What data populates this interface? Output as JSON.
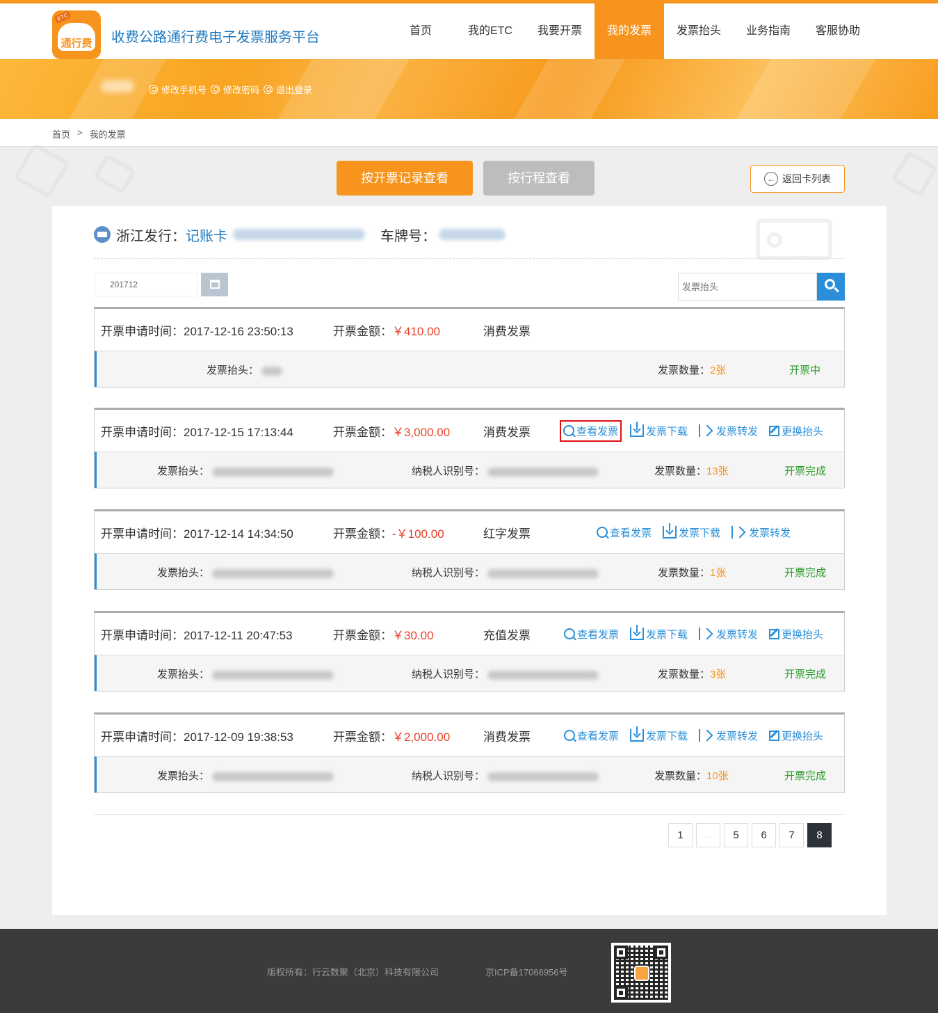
{
  "header": {
    "logo_text": "通行费",
    "logo_tag": "ETC",
    "site_title": "收费公路通行费电子发票服务平台",
    "nav": [
      {
        "label": "首页",
        "active": false
      },
      {
        "label": "我的ETC",
        "active": false
      },
      {
        "label": "我要开票",
        "active": false
      },
      {
        "label": "我的发票",
        "active": true
      },
      {
        "label": "发票抬头",
        "active": false
      },
      {
        "label": "业务指南",
        "active": false
      },
      {
        "label": "客服协助",
        "active": false
      }
    ]
  },
  "banner": {
    "links": [
      "修改手机号",
      "修改密码",
      "退出登录"
    ]
  },
  "breadcrumb": {
    "home": "首页",
    "sep": ">",
    "current": "我的发票"
  },
  "view_toggle": {
    "by_record": "按开票记录查看",
    "by_trip": "按行程查看"
  },
  "back_button": {
    "label": "返回卡列表"
  },
  "card_info": {
    "issuer": "浙江发行：",
    "card_type": "记账卡",
    "plate_label": "车牌号："
  },
  "filters": {
    "date_value": "201712",
    "search_placeholder": "发票抬头"
  },
  "labels": {
    "time": "开票申请时间：",
    "amount": "开票金额：",
    "head": "发票抬头：",
    "tax": "纳税人识别号：",
    "count": "发票数量：",
    "view": "查看发票",
    "download": "发票下载",
    "forward": "发票转发",
    "change_head": "更换抬头"
  },
  "invoices": [
    {
      "time": "2017-12-16 23:50:13",
      "amount": "￥410.00",
      "type": "消费发票",
      "count": "2张",
      "status": "开票中"
    },
    {
      "time": "2017-12-15 17:13:44",
      "amount": "￥3,000.00",
      "type": "消费发票",
      "count": "13张",
      "status": "开票完成"
    },
    {
      "time": "2017-12-14 14:34:50",
      "amount": "-￥100.00",
      "type": "红字发票",
      "count": "1张",
      "status": "开票完成"
    },
    {
      "time": "2017-12-11 20:47:53",
      "amount": "￥30.00",
      "type": "充值发票",
      "count": "3张",
      "status": "开票完成"
    },
    {
      "time": "2017-12-09 19:38:53",
      "amount": "￥2,000.00",
      "type": "消费发票",
      "count": "10张",
      "status": "开票完成"
    }
  ],
  "pagination": {
    "pages": [
      "1",
      "…",
      "5",
      "6",
      "7",
      "8"
    ],
    "current": "8"
  },
  "footer": {
    "copyright": "版权所有：行云数聚（北京）科技有限公司",
    "icp": "京ICP备17066956号"
  },
  "colors": {
    "accent": "#f7941d",
    "link": "#2a8fd8",
    "amount": "#e8412a",
    "status": "#2a9d2a"
  }
}
